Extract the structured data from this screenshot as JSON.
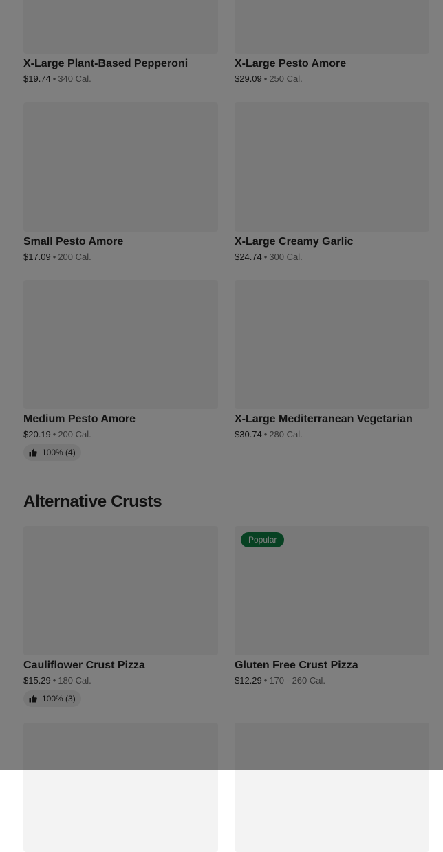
{
  "section": {
    "title": "Alternative Crusts"
  },
  "items": [
    {
      "title": "X-Large Plant-Based Pepperoni",
      "price": "$19.74",
      "calories": "340 Cal."
    },
    {
      "title": "X-Large Pesto Amore",
      "price": "$29.09",
      "calories": "250 Cal."
    },
    {
      "title": "Small Pesto Amore",
      "price": "$17.09",
      "calories": "200 Cal."
    },
    {
      "title": "X-Large Creamy Garlic",
      "price": "$24.74",
      "calories": "300 Cal."
    },
    {
      "title": "Medium Pesto Amore",
      "price": "$20.19",
      "calories": "200 Cal.",
      "rating": "100% (4)"
    },
    {
      "title": "X-Large Mediterranean Vegetarian",
      "price": "$30.74",
      "calories": "280 Cal."
    },
    {
      "title": "Cauliflower Crust Pizza",
      "price": "$15.29",
      "calories": "180 Cal.",
      "rating": "100% (3)"
    },
    {
      "title": "Gluten Free Crust Pizza",
      "price": "$12.29",
      "calories": "170 - 260 Cal.",
      "badge": "Popular"
    }
  ],
  "separator": "•",
  "icons": {
    "rating": "thumbs-up-icon"
  },
  "colors": {
    "badge": "#0e8345",
    "overlay": "rgba(0,0,0,0.5)"
  }
}
